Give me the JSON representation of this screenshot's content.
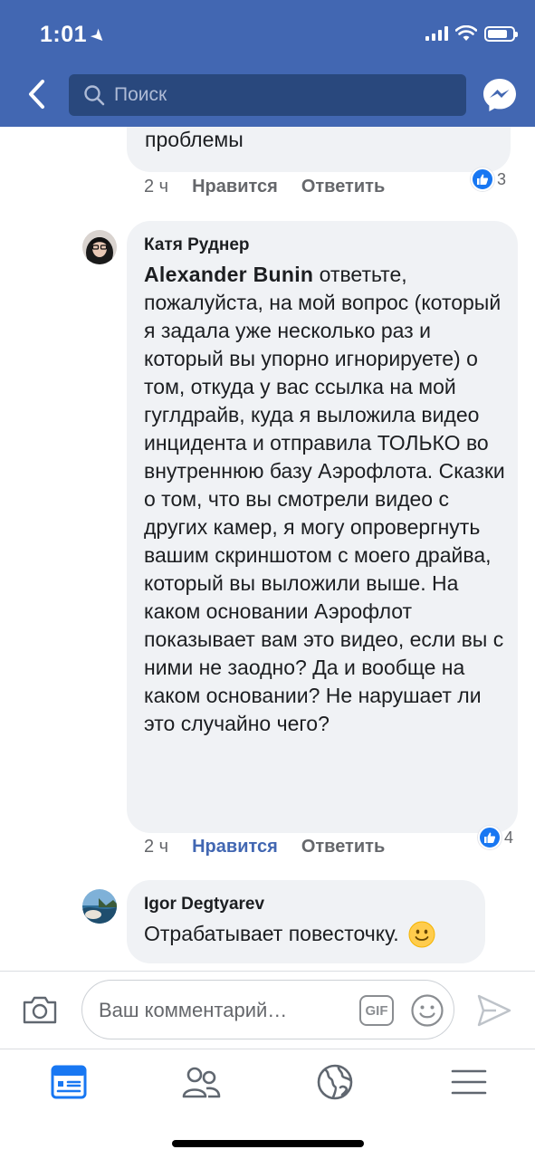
{
  "status_bar": {
    "time": "1:01"
  },
  "header": {
    "search": {
      "placeholder": "Поиск"
    }
  },
  "comments": [
    {
      "partial_text": "Но это исключительно мои\nпроблемы",
      "time": "2 ч",
      "like_label": "Нравится",
      "reply_label": "Ответить",
      "reactions": "3"
    },
    {
      "author": "Катя Руднер",
      "mention": "Alexander  Bunin",
      "text": " ответьте, пожалуйста, на мой вопрос (который я задала уже несколько раз и который вы упорно игнорируете) о том, откуда у вас ссылка на мой гуглдрайв, куда я выложила видео инцидента и отправила ТОЛЬКО во внутреннюю базу Аэрофлота. Сказки о том, что вы смотрели видео с других камер, я могу опровергнуть вашим скриншотом с моего драйва, который вы выложили выше. На каком основании Аэрофлот показывает вам это видео, если вы с ними не заодно? Да и вообще на каком основании? Не нарушает  ли это случайно чего?",
      "time": "2 ч",
      "like_label": "Нравится",
      "reply_label": "Ответить",
      "reactions": "4",
      "liked": true
    },
    {
      "author": "Igor Degtyarev",
      "text": "Отрабатывает повесточку.",
      "emoji": "slightly-smiling-face"
    }
  ],
  "composer": {
    "placeholder": "Ваш комментарий…",
    "gif_label": "GIF"
  },
  "tabs": [
    {
      "name": "news-feed",
      "active": true
    },
    {
      "name": "friends",
      "active": false
    },
    {
      "name": "notifications-globe",
      "active": false
    },
    {
      "name": "menu",
      "active": false
    }
  ],
  "colors": {
    "header": "#4267b2",
    "search_bg": "#29487d",
    "bubble": "#f0f2f5",
    "like_active": "#4267b2",
    "reaction_blue": "#1877f2"
  }
}
